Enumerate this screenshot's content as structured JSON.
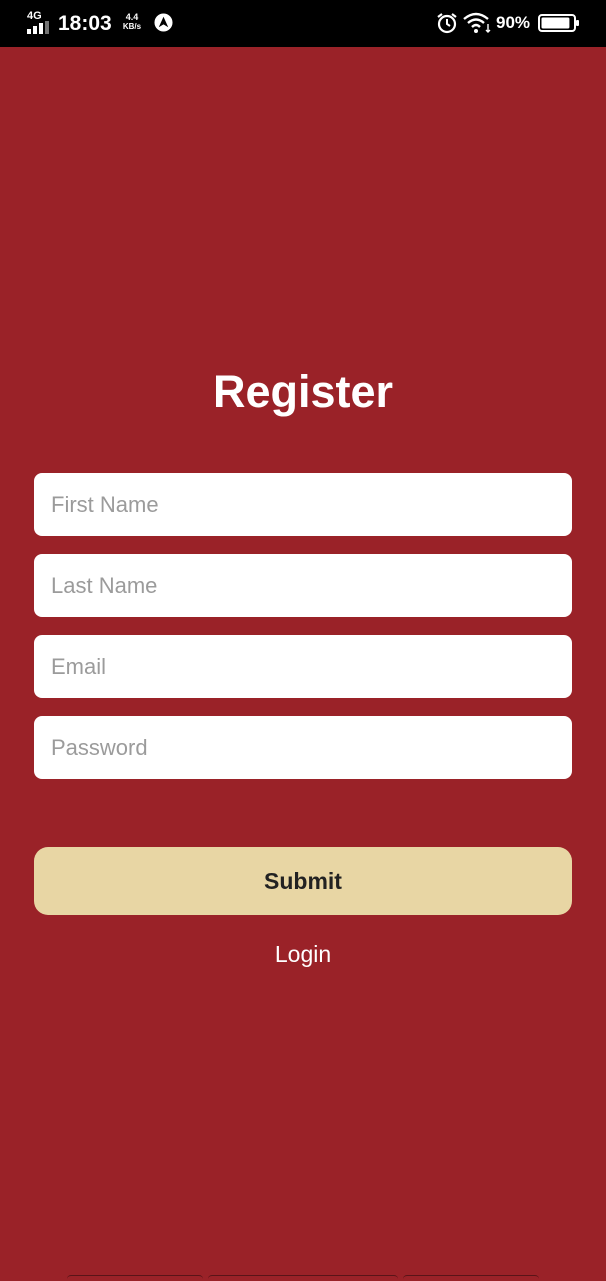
{
  "status_bar": {
    "network": "4G",
    "time": "18:03",
    "speed_value": "4.4",
    "speed_unit": "KB/s",
    "battery": "90%",
    "battery_level": 0.9
  },
  "register": {
    "title": "Register",
    "fields": {
      "first_name": {
        "placeholder": "First Name",
        "value": ""
      },
      "last_name": {
        "placeholder": "Last Name",
        "value": ""
      },
      "email": {
        "placeholder": "Email",
        "value": ""
      },
      "password": {
        "placeholder": "Password",
        "value": ""
      }
    },
    "submit_label": "Submit",
    "login_label": "Login"
  },
  "colors": {
    "background": "#9a2228",
    "submit_button": "#e8d6a4",
    "input_background": "#ffffff",
    "status_bar": "#000000"
  }
}
